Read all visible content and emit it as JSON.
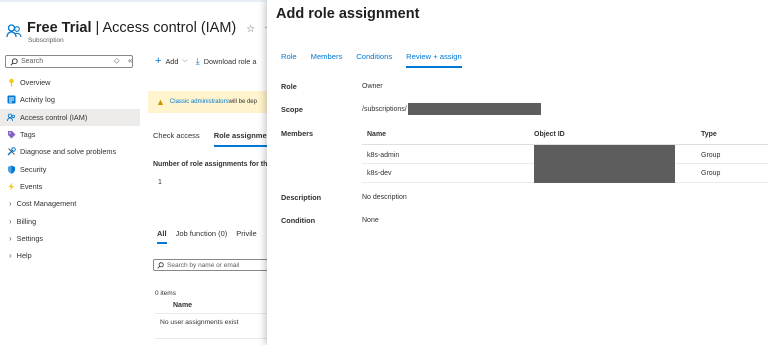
{
  "header": {
    "title_bold": "Free Trial",
    "title_rest": " | Access control (IAM)",
    "subtitle": "Subscription",
    "star_icon": "star-outline-icon",
    "more_icon": "ellipsis-icon"
  },
  "sidebar": {
    "search_placeholder": "Search",
    "items": [
      {
        "label": "Overview",
        "icon": "key-icon"
      },
      {
        "label": "Activity log",
        "icon": "activity-log-icon"
      },
      {
        "label": "Access control (IAM)",
        "icon": "people-icon"
      },
      {
        "label": "Tags",
        "icon": "tag-icon"
      },
      {
        "label": "Diagnose and solve problems",
        "icon": "wrench-icon"
      },
      {
        "label": "Security",
        "icon": "shield-icon"
      },
      {
        "label": "Events",
        "icon": "lightning-icon"
      },
      {
        "label": "Cost Management",
        "icon": "chevron-right-icon"
      },
      {
        "label": "Billing",
        "icon": "chevron-right-icon"
      },
      {
        "label": "Settings",
        "icon": "chevron-right-icon"
      },
      {
        "label": "Help",
        "icon": "chevron-right-icon"
      }
    ]
  },
  "toolbar": {
    "add_label": "Add",
    "download_label": "Download role a"
  },
  "banner": {
    "link_text": "Classic administrators",
    "rest_text": " will be dep"
  },
  "content_tabs": [
    "Check access",
    "Role assignment"
  ],
  "role_assignments": {
    "label": "Number of role assignments for th",
    "value": "1"
  },
  "filter_tabs": [
    "All",
    "Job function (0)",
    "Privile"
  ],
  "user_search_placeholder": "Search by name or email",
  "user_list": {
    "count": "0 items",
    "name_header": "Name",
    "empty_text": "No user assignments exist"
  },
  "blade": {
    "title": "Add role assignment",
    "tabs": [
      "Role",
      "Members",
      "Conditions",
      "Review + assign"
    ],
    "fields": {
      "role_label": "Role",
      "role_value": "Owner",
      "scope_label": "Scope",
      "scope_value": "/subscriptions/",
      "members_label": "Members",
      "description_label": "Description",
      "description_value": "No description",
      "condition_label": "Condition",
      "condition_value": "None"
    },
    "members_table": {
      "headers": [
        "Name",
        "Object ID",
        "Type"
      ],
      "rows": [
        {
          "name": "k8s-admin",
          "type": "Group"
        },
        {
          "name": "k8s-dev",
          "type": "Group"
        }
      ]
    }
  },
  "colors": {
    "accent": "#0078d4",
    "warning_bg": "#fff4ce",
    "redaction": "#5d5d5d"
  }
}
